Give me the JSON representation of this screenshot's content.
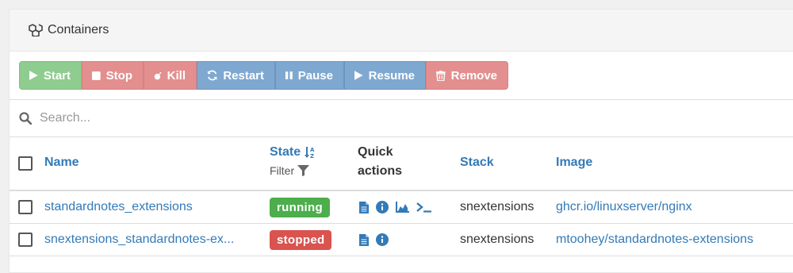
{
  "panel": {
    "title": "Containers"
  },
  "toolbar": {
    "start": "Start",
    "stop": "Stop",
    "kill": "Kill",
    "restart": "Restart",
    "pause": "Pause",
    "resume": "Resume",
    "remove": "Remove"
  },
  "search": {
    "placeholder": "Search..."
  },
  "table": {
    "headers": {
      "name": "Name",
      "state": "State",
      "state_filter": "Filter",
      "quick_actions_line1": "Quick",
      "quick_actions_line2": "actions",
      "stack": "Stack",
      "image": "Image"
    },
    "rows": [
      {
        "name": "standardnotes_extensions",
        "state": "running",
        "stack": "snextensions",
        "image": "ghcr.io/linuxserver/nginx"
      },
      {
        "name": "snextensions_standardnotes-ex...",
        "state": "stopped",
        "stack": "snextensions",
        "image": "mtoohey/standardnotes-extensions"
      }
    ]
  },
  "colors": {
    "running": "#4cae4c",
    "stopped": "#d9534f",
    "link": "#337ab7"
  }
}
